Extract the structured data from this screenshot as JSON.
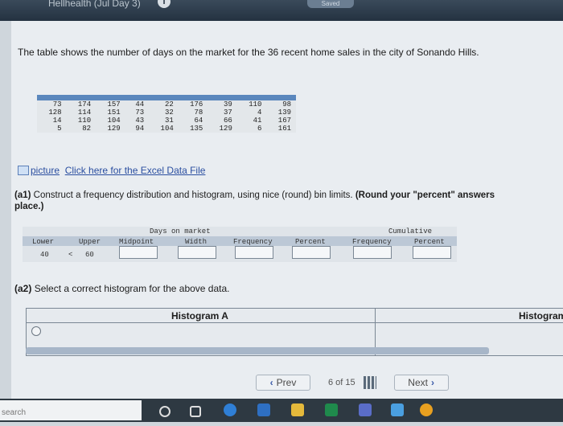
{
  "header": {
    "title_fragment": "Hellhealth (Jul Day 3)",
    "info_icon": "info-icon",
    "status": "Saved"
  },
  "intro_text": "The table shows the number of days on the market for the 36 recent home sales in the city of Sonando Hills.",
  "data_table": {
    "rows": [
      [
        "73",
        "174",
        "157",
        "44",
        "22",
        "176",
        "39",
        "110",
        "98"
      ],
      [
        "128",
        "114",
        "151",
        "73",
        "32",
        "78",
        "37",
        "4",
        "139"
      ],
      [
        "14",
        "110",
        "104",
        "43",
        "31",
        "64",
        "66",
        "41",
        "167"
      ],
      [
        "5",
        "82",
        "129",
        "94",
        "104",
        "135",
        "129",
        "6",
        "161"
      ]
    ]
  },
  "excel_link": {
    "icon": "picture-icon",
    "alt": "picture",
    "label": "Click here for the Excel Data File"
  },
  "question_a1": {
    "label": "(a1)",
    "text": "Construct a frequency distribution and histogram, using nice (round) bin limits.",
    "bold": "(Round your \"percent\" answers",
    "tail": "place.)"
  },
  "freq_table": {
    "group_days": "Days on market",
    "group_cumulative": "Cumulative",
    "headers": {
      "lower": "Lower",
      "upper": "Upper",
      "midpoint": "Midpoint",
      "width": "Width",
      "frequency": "Frequency",
      "percent": "Percent",
      "cum_frequency": "Frequency",
      "cum_percent": "Percent"
    },
    "row": {
      "lower": "40",
      "sep": "<",
      "upper": "60"
    }
  },
  "question_a2": {
    "label": "(a2)",
    "text": "Select a correct histogram for the above data."
  },
  "histograms": {
    "a": "Histogram A",
    "b": "Histogram"
  },
  "pager": {
    "prev": "Prev",
    "page": "6 of 15",
    "next": "Next"
  },
  "taskbar": {
    "search": "search"
  },
  "colors": {
    "table_header": "#5a87bd",
    "link": "#2a4ea0",
    "taskbar": "#2e3942"
  }
}
